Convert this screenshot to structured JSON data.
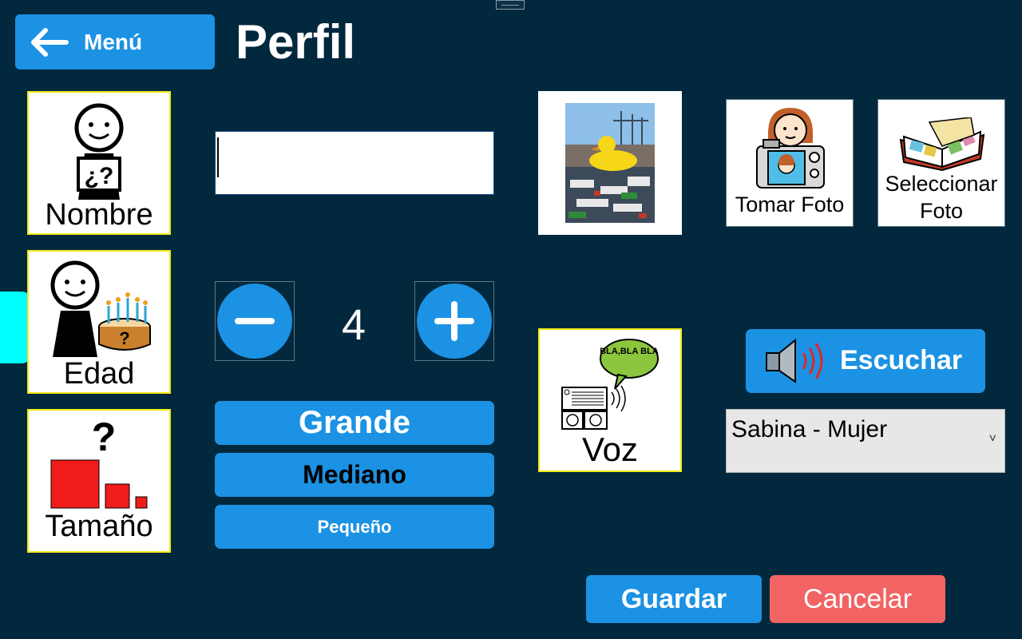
{
  "header": {
    "menu_label": "Menú",
    "title": "Perfil"
  },
  "cards": {
    "name_label": "Nombre",
    "age_label": "Edad",
    "size_label": "Tamaño",
    "voice_label": "Voz"
  },
  "name_field": {
    "value": ""
  },
  "age": {
    "value": "4"
  },
  "size_options": [
    {
      "label": "Grande"
    },
    {
      "label": "Mediano"
    },
    {
      "label": "Pequeño"
    }
  ],
  "photo": {
    "take_label": "Tomar Foto",
    "select_label_1": "Seleccionar",
    "select_label_2": "Foto"
  },
  "voice": {
    "listen_label": "Escuchar",
    "selected": "Sabina - Mujer",
    "bubble_text": "BLA,BLA BLA"
  },
  "footer": {
    "save_label": "Guardar",
    "cancel_label": "Cancelar"
  },
  "colors": {
    "background": "#02283d",
    "accent": "#1b92e3",
    "cancel": "#f26363",
    "card_border": "#f2ea17",
    "side_tab": "#00ffff"
  }
}
